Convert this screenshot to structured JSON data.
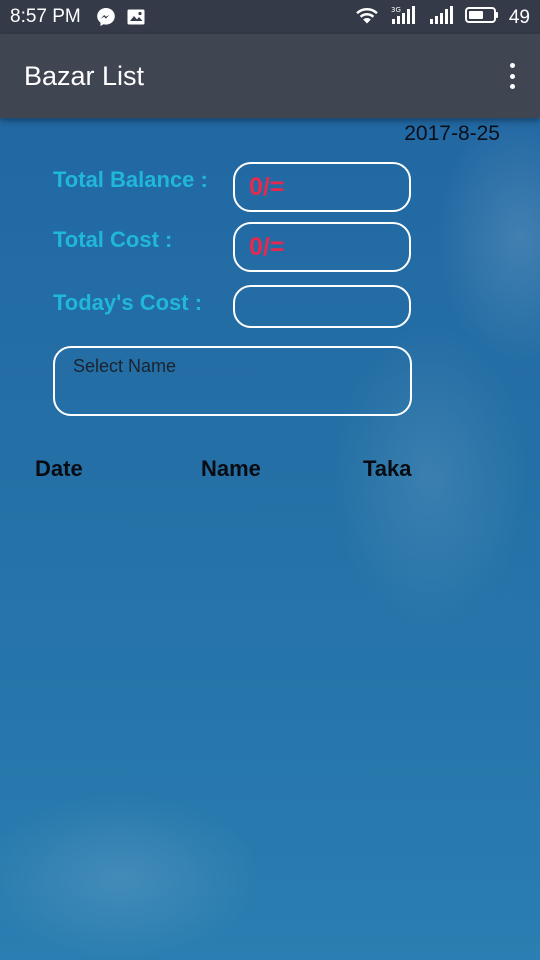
{
  "status_bar": {
    "time": "8:57 PM",
    "left_icons": [
      "messenger-icon",
      "image-notification-icon"
    ],
    "right_icons": [
      "wifi-icon",
      "signal-3g-icon",
      "signal-icon"
    ],
    "battery_percent": "49"
  },
  "app_bar": {
    "title": "Bazar List",
    "menu_icon": "more-vert-icon"
  },
  "main": {
    "date": "2017-8-25",
    "total_balance": {
      "label": "Total Balance :",
      "value": "0/="
    },
    "total_cost": {
      "label": "Total Cost :",
      "value": "0/="
    },
    "todays_cost": {
      "label": "Today's Cost :",
      "value": ""
    },
    "select_name": {
      "placeholder": "Select Name"
    }
  },
  "table": {
    "columns": [
      "Date",
      "Name",
      "Taka"
    ],
    "rows": []
  },
  "colors": {
    "status_bar_bg": "#343a47",
    "app_bar_bg": "#404552",
    "label_color": "#20b7db",
    "value_color": "#e5294f",
    "content_bg": "#2470a6"
  }
}
